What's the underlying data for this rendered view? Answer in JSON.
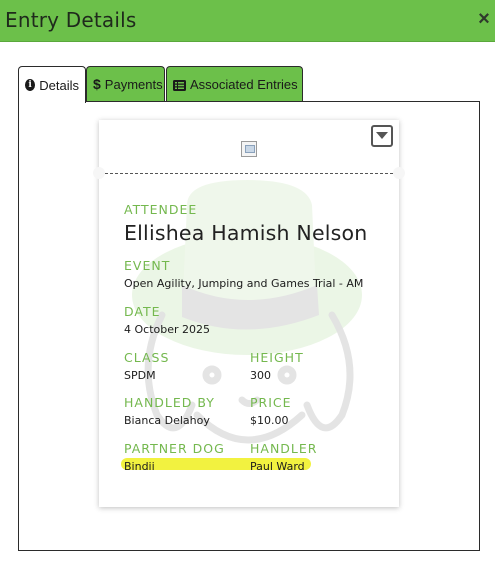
{
  "dialog": {
    "title": "Entry Details",
    "close_glyph": "×"
  },
  "tabs": [
    {
      "label": "Details",
      "icon": "info-circle-icon",
      "active": true
    },
    {
      "label": "Payments",
      "icon": "dollar-icon",
      "active": false
    },
    {
      "label": "Associated Entries",
      "icon": "list-icon",
      "active": false
    }
  ],
  "entry": {
    "attendee_label": "ATTENDEE",
    "attendee": "Ellishea Hamish Nelson",
    "event_label": "EVENT",
    "event": "Open Agility, Jumping and Games Trial - AM",
    "date_label": "DATE",
    "date": "4 October 2025",
    "class_label": "CLASS",
    "class": "SPDM",
    "height_label": "HEIGHT",
    "height": "300",
    "handled_by_label": "HANDLED BY",
    "handled_by": "Bianca Delahoy",
    "price_label": "PRICE",
    "price": "$10.00",
    "partner_dog_label": "PARTNER DOG",
    "partner_dog": "Bindii",
    "handler_label": "HANDLER",
    "handler": "Paul Ward"
  },
  "colors": {
    "accent": "#6cc04a",
    "label": "#74b84e",
    "highlight": "#f0f01e"
  }
}
